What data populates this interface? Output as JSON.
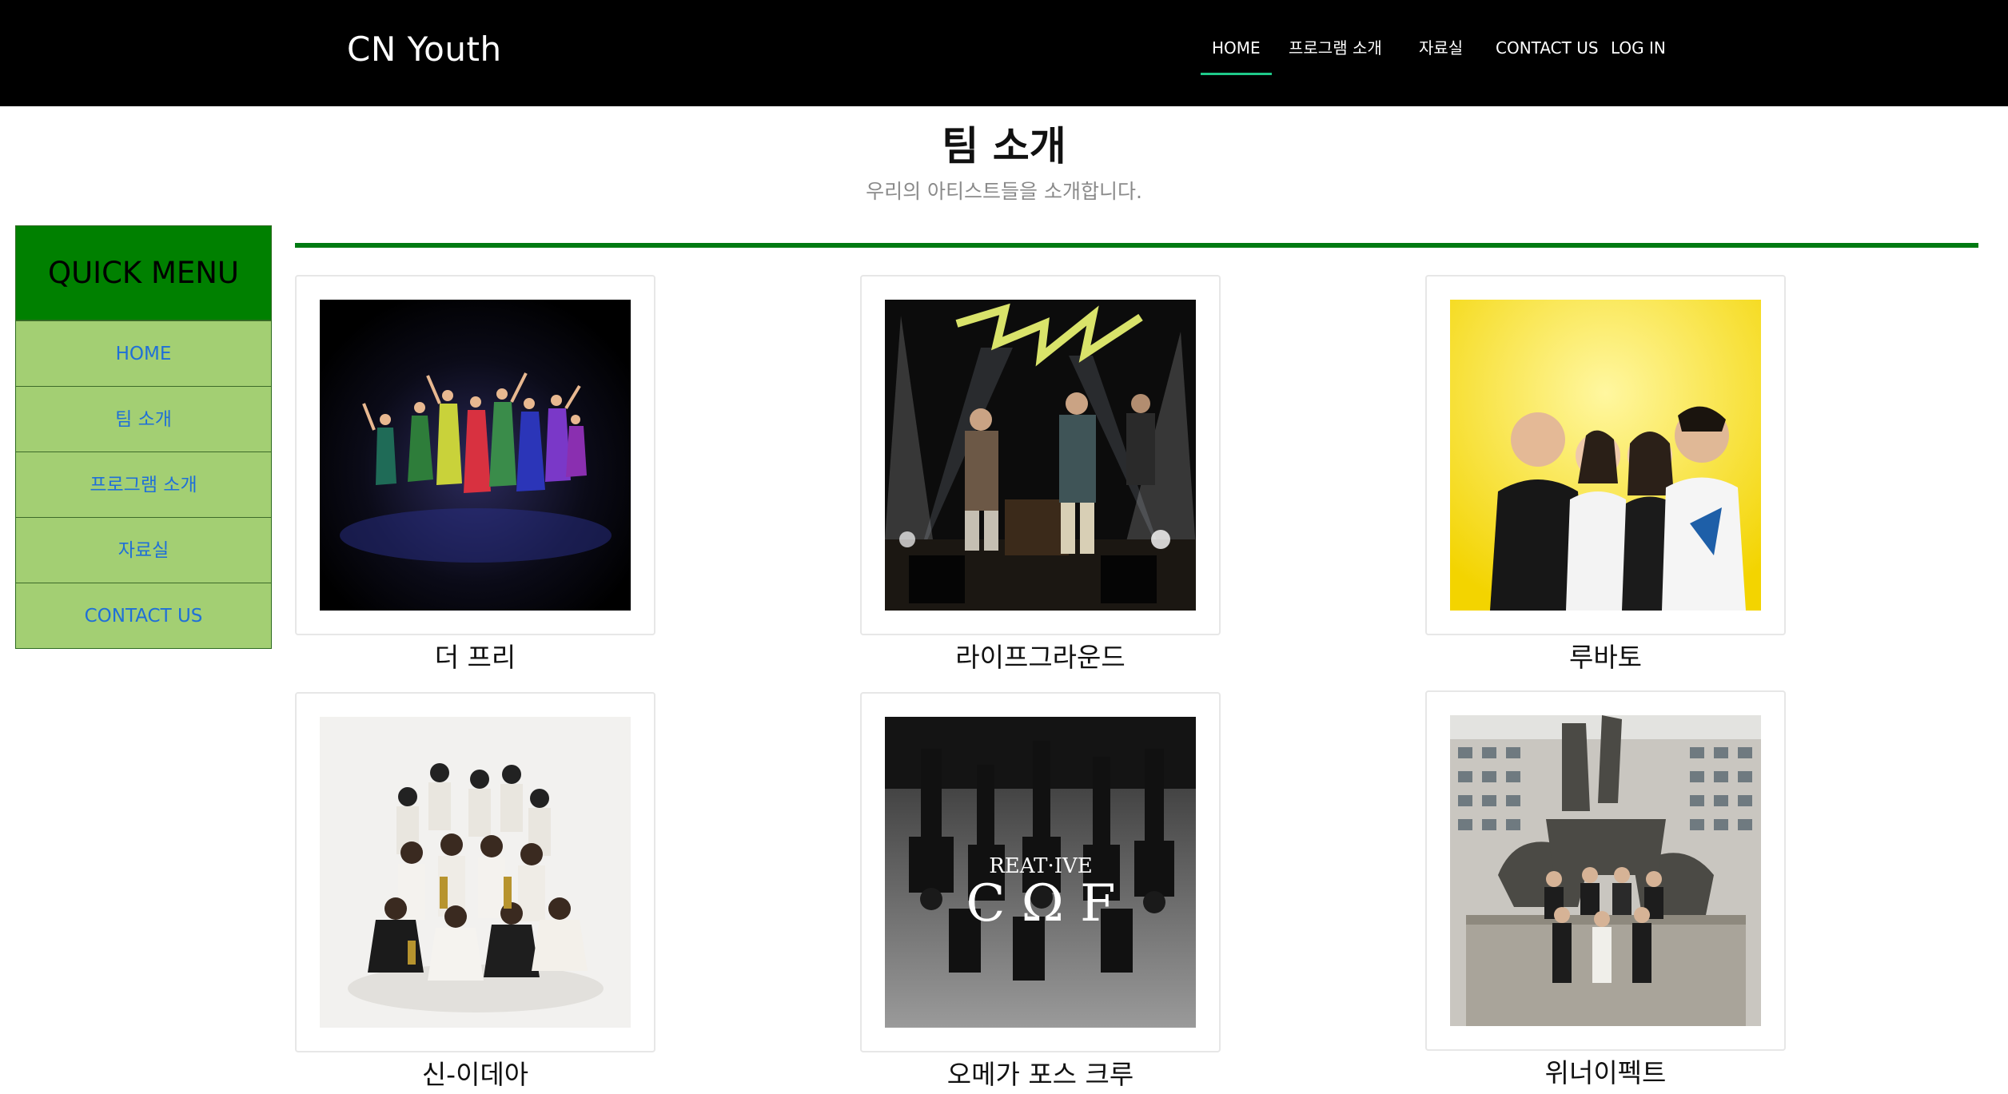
{
  "header": {
    "brand": "CN Youth",
    "nav": [
      {
        "label": "HOME",
        "active": true
      },
      {
        "label": "프로그램 소개",
        "active": false
      },
      {
        "label": "자료실",
        "active": false
      },
      {
        "label": "CONTACT US",
        "active": false
      },
      {
        "label": "LOG IN",
        "active": false
      }
    ]
  },
  "page": {
    "title": "팀 소개",
    "subtitle": "우리의 아티스트들을 소개합니다."
  },
  "quick_menu": {
    "title": "QUICK MENU",
    "items": [
      "HOME",
      "팀 소개",
      "프로그램 소개",
      "자료실",
      "CONTACT US"
    ]
  },
  "teams": [
    {
      "name": "더 프리"
    },
    {
      "name": "라이프그라운드"
    },
    {
      "name": "루바토"
    },
    {
      "name": "신-이데아"
    },
    {
      "name": "오메가 포스 크루"
    },
    {
      "name": "위너이펙트"
    }
  ],
  "photo_text": {
    "omega_logo_top": "REAT·IVE",
    "omega_logo_letters": "C Ω F"
  },
  "colors": {
    "topbar": "#000000",
    "nav_active_underline": "#1fc98a",
    "quick_menu_header": "#008000",
    "quick_menu_item": "#a3cf73",
    "quick_menu_link": "#1f6fd8",
    "divider": "#007a12"
  }
}
